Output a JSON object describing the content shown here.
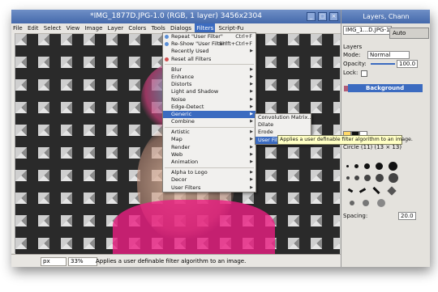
{
  "window": {
    "title": "*IMG_1877D.JPG-1.0 (RGB, 1 layer) 3456x2304",
    "buttons": [
      "_",
      "□",
      "×"
    ]
  },
  "menubar": [
    "File",
    "Edit",
    "Select",
    "View",
    "Image",
    "Layer",
    "Colors",
    "Tools",
    "Dialogs",
    "Filters",
    "Script-Fu"
  ],
  "filters_menu": {
    "items": [
      {
        "label": "Repeat \"User Filter\"",
        "shortcut": "Ctrl+F"
      },
      {
        "label": "Re-Show \"User Filter\"",
        "shortcut": "Shift+Ctrl+F"
      },
      {
        "label": "Recently Used"
      },
      {
        "label": "Reset all Filters"
      },
      {
        "label": "Blur"
      },
      {
        "label": "Enhance"
      },
      {
        "label": "Distorts"
      },
      {
        "label": "Light and Shadow"
      },
      {
        "label": "Noise"
      },
      {
        "label": "Edge-Detect"
      },
      {
        "label": "Generic"
      },
      {
        "label": "Combine"
      },
      {
        "label": "Artistic"
      },
      {
        "label": "Map"
      },
      {
        "label": "Render"
      },
      {
        "label": "Web"
      },
      {
        "label": "Animation"
      },
      {
        "label": "Alpha to Logo"
      },
      {
        "label": "Decor"
      },
      {
        "label": "User Filters"
      }
    ]
  },
  "generic_submenu": [
    "Convolution Matrix...",
    "Dilate",
    "Erode",
    "User Filter..."
  ],
  "tooltip": "Applies a user definable filter algorithm to an image.",
  "statusbar": {
    "unit": "px",
    "zoom": "33%",
    "message": "Applies a user definable filter algorithm to an image."
  },
  "dock": {
    "title": "Layers, Chann",
    "image_selector": "IMG_1...D.JPG-1",
    "auto_label": "Auto",
    "tab": "Layers",
    "mode_label": "Mode:",
    "mode_value": "Normal",
    "opacity_label": "Opacity:",
    "opacity_value": "100.0",
    "lock_label": "Lock:",
    "layer_name": "Background",
    "brush_label": "Circle (11) (13 × 13)",
    "spacing_label": "Spacing:",
    "spacing_value": "20.0"
  }
}
